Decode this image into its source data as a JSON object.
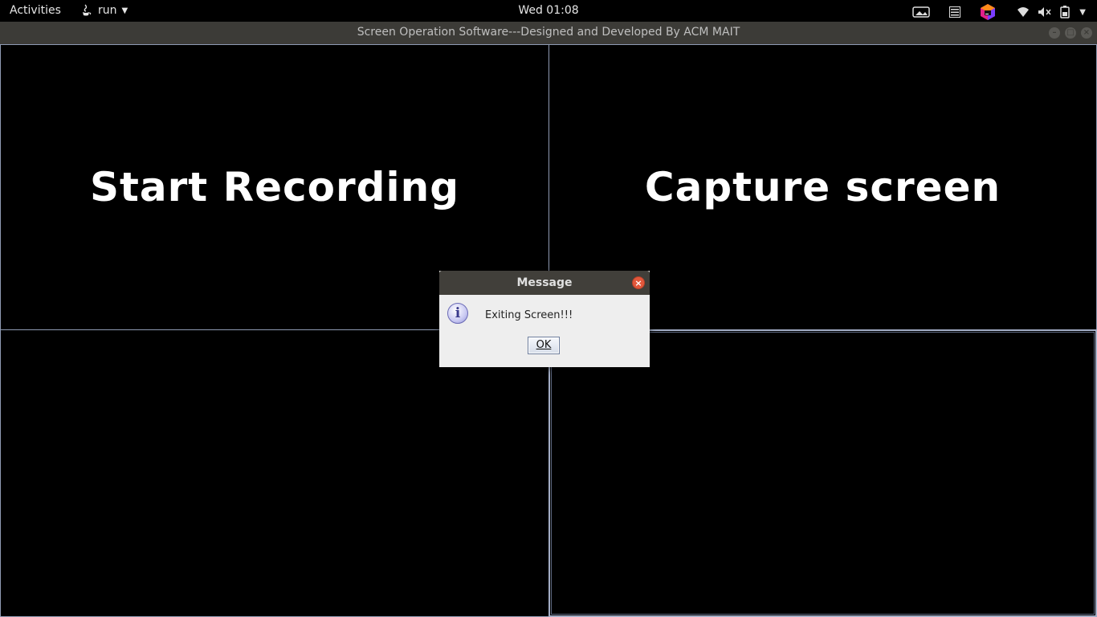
{
  "topbar": {
    "activities": "Activities",
    "app_name": "run",
    "clock": "Wed 01:08",
    "icons": [
      "screen-icon",
      "menu-icon",
      "app-cube-icon",
      "wifi-icon",
      "volume-mute-icon",
      "battery-icon",
      "chevron-down-icon"
    ]
  },
  "window": {
    "title": "Screen Operation Software---Designed and Developed By ACM MAIT"
  },
  "panels": {
    "start_recording": "Start Recording",
    "capture_screen": "Capture screen"
  },
  "dialog": {
    "title": "Message",
    "message": "Exiting Screen!!!",
    "ok_label": "OK"
  }
}
